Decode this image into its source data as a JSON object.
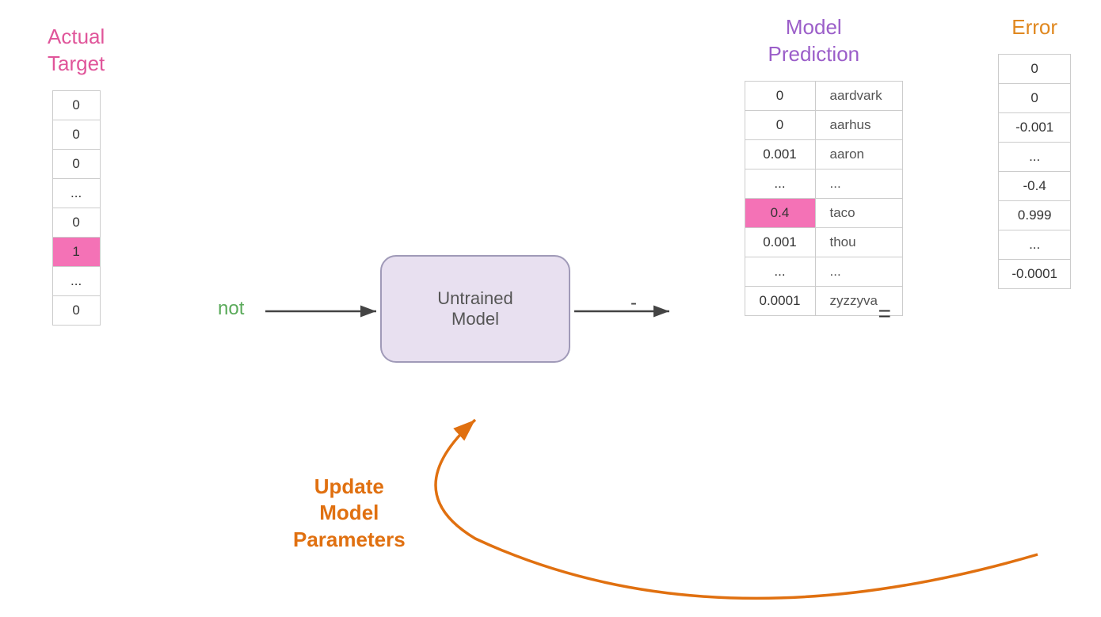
{
  "actualTarget": {
    "title": "Actual\nTarget",
    "values": [
      "0",
      "0",
      "0",
      "...",
      "0",
      "1",
      "...",
      "0"
    ],
    "highlightRow": 5
  },
  "model": {
    "label": "Untrained Model",
    "inputLabel": "not",
    "dashedDivider": "-"
  },
  "prediction": {
    "title": "Model\nPrediction",
    "rows": [
      {
        "value": "0",
        "word": "aardvark"
      },
      {
        "value": "0",
        "word": "aarhus"
      },
      {
        "value": "0.001",
        "word": "aaron"
      },
      {
        "value": "...",
        "word": "..."
      },
      {
        "value": "0.4",
        "word": "taco"
      },
      {
        "value": "0.001",
        "word": "thou"
      },
      {
        "value": "...",
        "word": "..."
      },
      {
        "value": "0.0001",
        "word": "zyzzyva"
      }
    ],
    "highlightRow": 4
  },
  "error": {
    "title": "Error",
    "values": [
      "0",
      "0",
      "-0.001",
      "...",
      "-0.4",
      "0.999",
      "...",
      "-0.0001"
    ]
  },
  "equalsSign": "=",
  "updateLabel": "Update\nModel\nParameters",
  "arrows": {
    "inputArrow": "→",
    "outputArrow": "→"
  }
}
